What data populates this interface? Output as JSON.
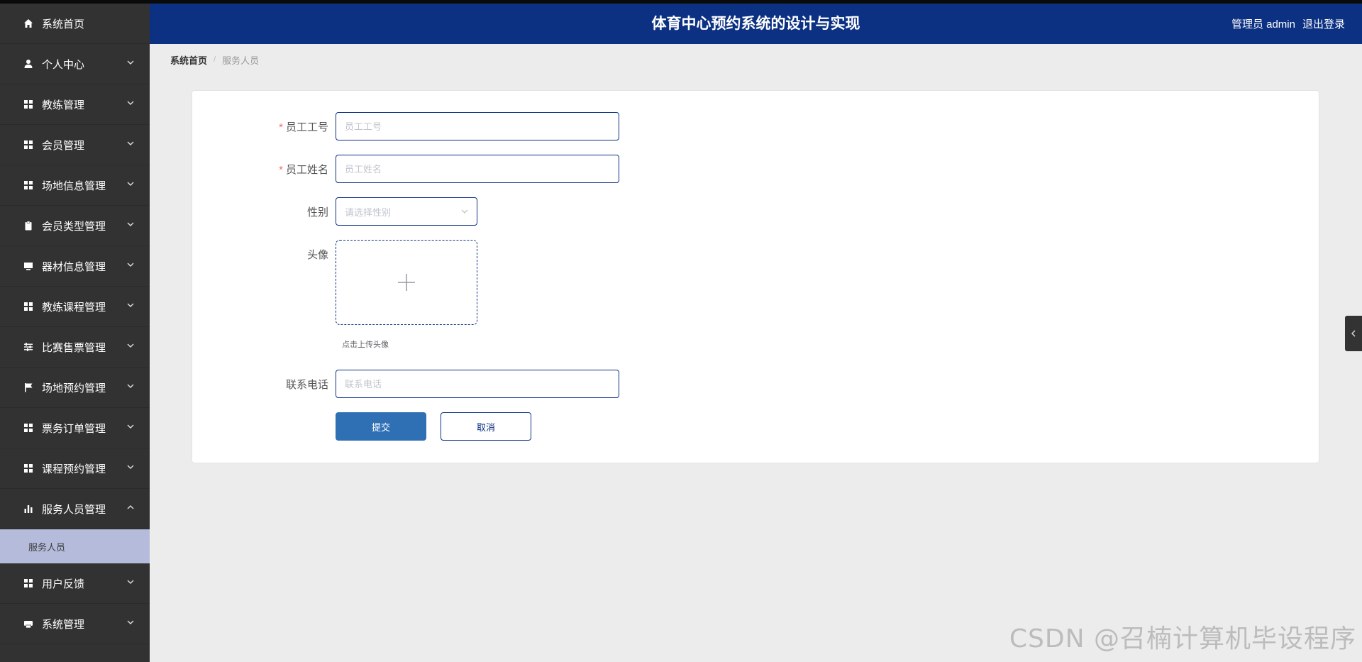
{
  "header": {
    "title": "体育中心预约系统的设计与实现",
    "user_label": "管理员 admin",
    "logout_label": "退出登录"
  },
  "sidebar": {
    "items": [
      {
        "label": "系统首页",
        "icon": "home-icon"
      },
      {
        "label": "个人中心",
        "icon": "user-icon"
      },
      {
        "label": "教练管理",
        "icon": "grid-icon"
      },
      {
        "label": "会员管理",
        "icon": "grid-icon"
      },
      {
        "label": "场地信息管理",
        "icon": "grid-icon"
      },
      {
        "label": "会员类型管理",
        "icon": "clipboard-icon"
      },
      {
        "label": "器材信息管理",
        "icon": "monitor-icon"
      },
      {
        "label": "教练课程管理",
        "icon": "grid-icon"
      },
      {
        "label": "比赛售票管理",
        "icon": "sliders-icon"
      },
      {
        "label": "场地预约管理",
        "icon": "flag-icon"
      },
      {
        "label": "票务订单管理",
        "icon": "grid-icon"
      },
      {
        "label": "课程预约管理",
        "icon": "grid-icon"
      },
      {
        "label": "服务人员管理",
        "icon": "bar-chart-icon",
        "expanded": true
      },
      {
        "label": "用户反馈",
        "icon": "grid-icon"
      },
      {
        "label": "系统管理",
        "icon": "printer-icon"
      }
    ],
    "active_submenu": "服务人员"
  },
  "breadcrumb": {
    "home": "系统首页",
    "separator": "/",
    "current": "服务人员"
  },
  "form": {
    "employee_id": {
      "label": "员工工号",
      "placeholder": "员工工号",
      "value": "",
      "required": true
    },
    "employee_name": {
      "label": "员工姓名",
      "placeholder": "员工姓名",
      "value": "",
      "required": true
    },
    "gender": {
      "label": "性别",
      "placeholder": "请选择性别"
    },
    "avatar": {
      "label": "头像",
      "hint": "点击上传头像"
    },
    "phone": {
      "label": "联系电话",
      "placeholder": "联系电话",
      "value": ""
    },
    "submit_label": "提交",
    "cancel_label": "取消"
  },
  "required_mark": "*",
  "watermark": "CSDN @召楠计算机毕设程序",
  "colors": {
    "header_bg": "#0c3182",
    "sidebar_bg": "#323232",
    "submenu_active_bg": "#b5bcdb",
    "primary_button": "#2f6fb4",
    "required": "#f56c6c"
  }
}
